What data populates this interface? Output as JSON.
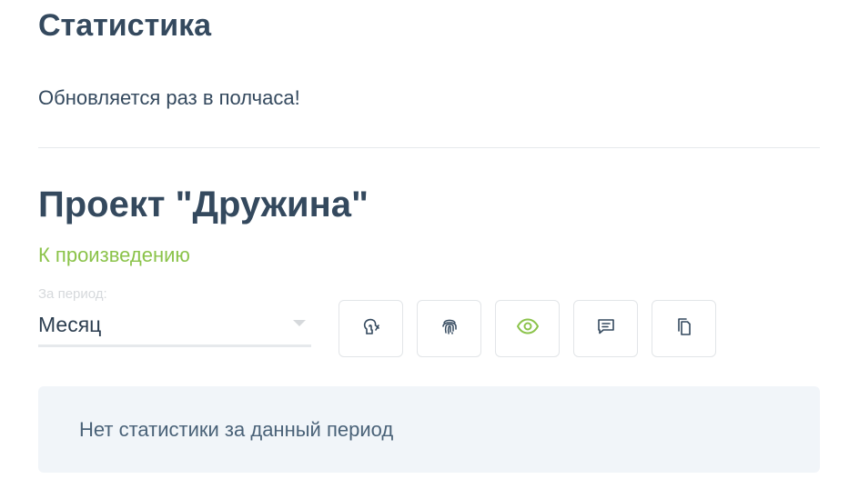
{
  "header": {
    "title": "Статистика",
    "subtitle": "Обновляется раз в полчаса!"
  },
  "project": {
    "title": "Проект \"Дружина\"",
    "link_label": "К произведению"
  },
  "period": {
    "label": "За период:",
    "selected": "Месяц"
  },
  "toolbar": {
    "buttons": [
      {
        "icon": "read-hand-icon",
        "active": false
      },
      {
        "icon": "fingerprint-icon",
        "active": false
      },
      {
        "icon": "eye-icon",
        "active": true
      },
      {
        "icon": "comment-icon",
        "active": false
      },
      {
        "icon": "copy-icon",
        "active": false
      }
    ]
  },
  "empty_state": {
    "message": "Нет статистики за данный период"
  },
  "colors": {
    "text": "#34495e",
    "accent": "#8bc34a",
    "muted": "#d6d9dc",
    "panel": "#f1f5f9"
  }
}
